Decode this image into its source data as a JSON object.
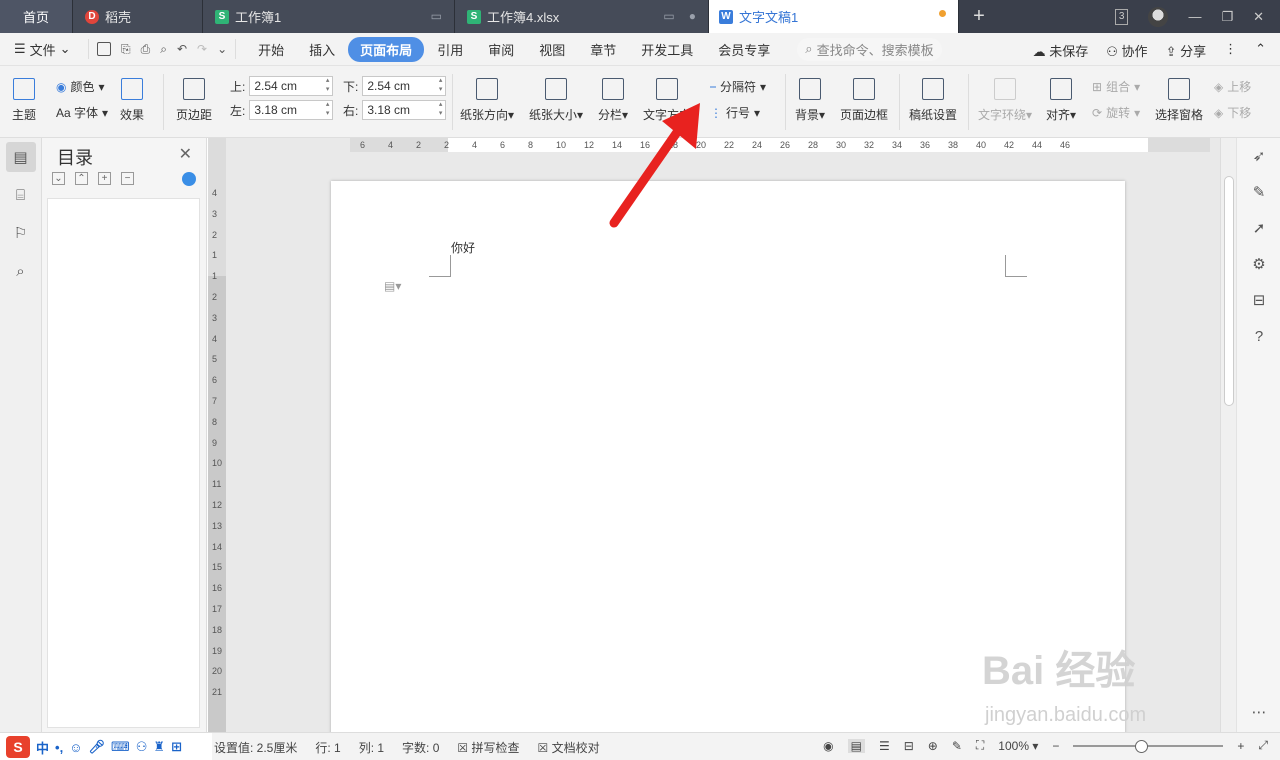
{
  "tabs": {
    "home": "首页",
    "t1": "稻壳",
    "t2": "工作簿1",
    "t3": "工作簿4.xlsx",
    "t4": "文字文稿1",
    "new_tab": "+",
    "window_count": "3"
  },
  "menubar": {
    "file": "文件",
    "items": [
      "开始",
      "插入",
      "页面布局",
      "引用",
      "审阅",
      "视图",
      "章节",
      "开发工具",
      "会员专享"
    ],
    "search_placeholder": "查找命令、搜索模板",
    "unsaved": "未保存",
    "collaborate": "协作",
    "share": "分享"
  },
  "ribbon": {
    "theme": "主题",
    "color": "颜色",
    "font": "Aa 字体",
    "effect": "效果",
    "margins": "页边距",
    "top_label": "上:",
    "top_value": "2.54 cm",
    "bottom_label": "下:",
    "bottom_value": "2.54 cm",
    "left_label": "左:",
    "left_value": "3.18 cm",
    "right_label": "右:",
    "right_value": "3.18 cm",
    "orientation": "纸张方向",
    "size": "纸张大小",
    "columns": "分栏",
    "text_direction": "文字方向",
    "breaks": "分隔符",
    "line_numbers": "行号",
    "background": "背景",
    "page_border": "页面边框",
    "draft_paper": "稿纸设置",
    "text_wrap": "文字环绕",
    "align": "对齐",
    "group": "组合",
    "rotate": "旋转",
    "selection_pane": "选择窗格",
    "bring_forward": "上移",
    "send_backward": "下移"
  },
  "toc": {
    "title": "目录"
  },
  "ruler": {
    "h_ticks": [
      "6",
      "4",
      "2",
      "2",
      "4",
      "6",
      "8",
      "10",
      "12",
      "14",
      "16",
      "18",
      "20",
      "22",
      "24",
      "26",
      "28",
      "30",
      "32",
      "34",
      "36",
      "38",
      "40",
      "42",
      "44",
      "46"
    ],
    "v_ticks": [
      "4",
      "3",
      "2",
      "1",
      "1",
      "2",
      "3",
      "4",
      "5",
      "6",
      "7",
      "8",
      "9",
      "10",
      "11",
      "12",
      "13",
      "14",
      "15",
      "16",
      "17",
      "18",
      "19",
      "20",
      "21"
    ]
  },
  "document": {
    "text": "你好"
  },
  "statusbar": {
    "ime_label": "中",
    "position": "设置值: 2.5厘米",
    "row": "行: 1",
    "col": "列: 1",
    "wordcount": "字数: 0",
    "spellcheck": "拼写检查",
    "doc_check": "文档校对",
    "zoom": "100%"
  },
  "watermark": {
    "brand": "Bai  经验",
    "url": "jingyan.baidu.com"
  }
}
